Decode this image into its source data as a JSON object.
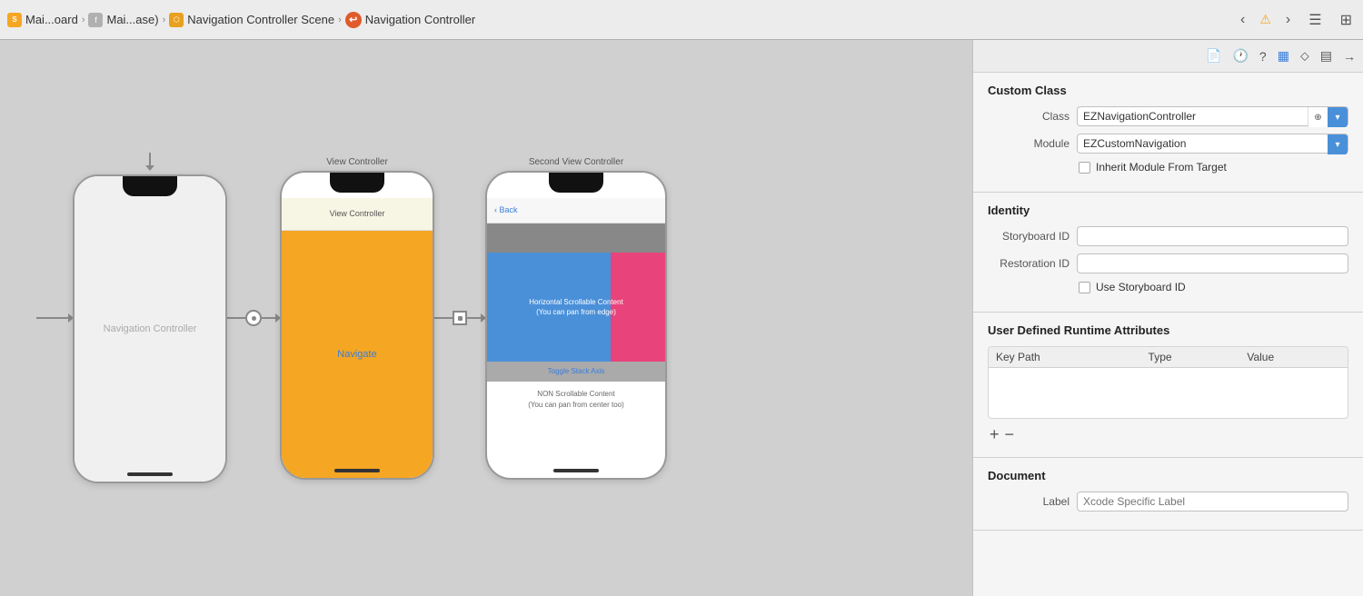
{
  "toolbar": {
    "breadcrumb": [
      {
        "label": "Mai...oard",
        "type": "storyboard"
      },
      {
        "label": "Mai...ase)",
        "type": "file"
      },
      {
        "label": "Navigation Controller Scene",
        "type": "scene"
      },
      {
        "label": "Navigation Controller",
        "type": "nav"
      }
    ],
    "buttons": [
      "chevron-left",
      "warning",
      "chevron-right",
      "menu",
      "add-editor"
    ]
  },
  "panel_toolbar_icons": [
    "file",
    "clock",
    "question",
    "identity",
    "pin",
    "slider",
    "arrow-right"
  ],
  "canvas": {
    "phones": [
      {
        "id": "nav-controller",
        "label": "",
        "type": "nav-controller",
        "has_entry_arrow": true
      },
      {
        "id": "view-controller",
        "label": "View Controller",
        "type": "view-controller"
      },
      {
        "id": "second-view-controller",
        "label": "Second View Controller",
        "type": "second-view-controller"
      }
    ],
    "nav_controller_text": "Navigation Controller",
    "navigate_label": "Navigate",
    "scrollable_text": "Horizontal Scrollable Content\n(You can pan from edge)",
    "toggle_text": "Toggle Stack Axis",
    "non_scrollable_text": "NON Scrollable Content\n(You can pan from center too)"
  },
  "right_panel": {
    "custom_class": {
      "title": "Custom Class",
      "class_label": "Class",
      "class_value": "EZNavigationController",
      "module_label": "Module",
      "module_value": "EZCustomNavigation",
      "inherit_label": "Inherit Module From Target"
    },
    "identity": {
      "title": "Identity",
      "storyboard_id_label": "Storyboard ID",
      "storyboard_id_value": "",
      "restoration_id_label": "Restoration ID",
      "restoration_id_value": "",
      "use_storyboard_label": "Use Storyboard ID"
    },
    "user_defined": {
      "title": "User Defined Runtime Attributes",
      "columns": [
        "Key Path",
        "Type",
        "Value"
      ],
      "rows": []
    },
    "add_btn": "+",
    "remove_btn": "−",
    "document": {
      "title": "Document",
      "label_label": "Label",
      "label_placeholder": "Xcode Specific Label"
    }
  }
}
